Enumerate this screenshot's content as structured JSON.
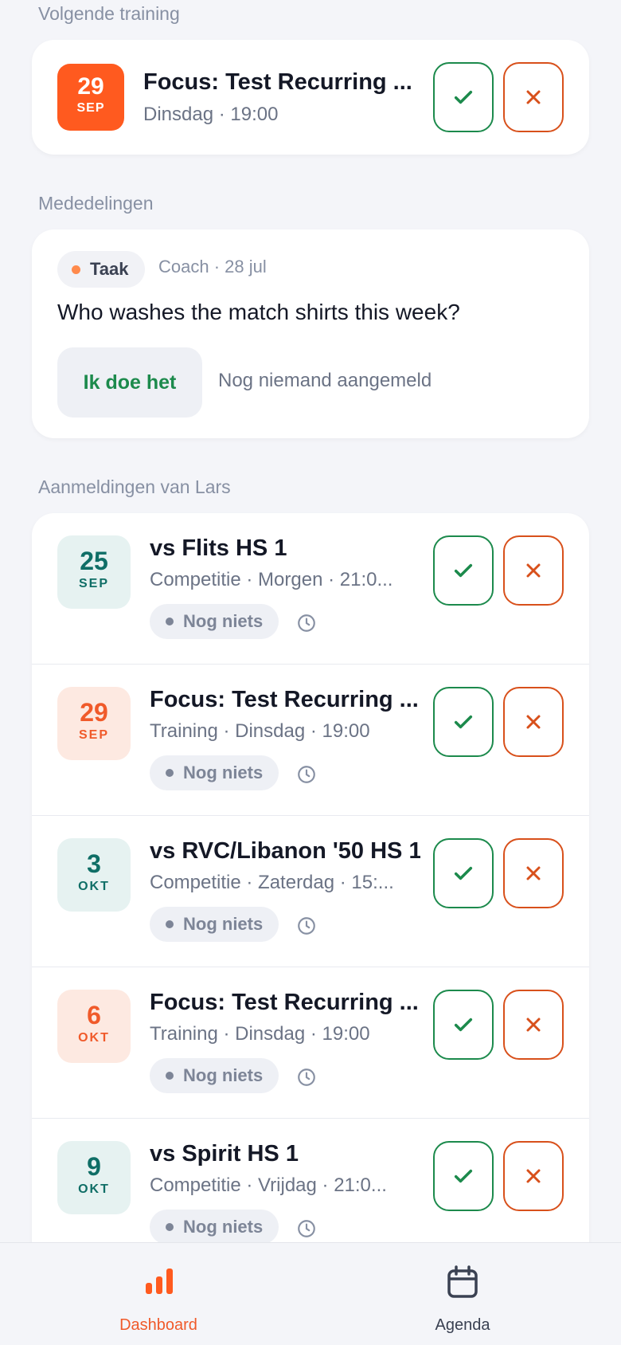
{
  "next_training": {
    "section_label": "Volgende training",
    "day": "29",
    "month": "SEP",
    "title": "Focus: Test Recurring ...",
    "subtitle": "Dinsdag · 19:00"
  },
  "announcements": {
    "section_label": "Mededelingen",
    "tag": "Taak",
    "meta": "Coach · 28 jul",
    "question": "Who washes the match shirts this week?",
    "action_label": "Ik doe het",
    "status": "Nog niemand aangemeld"
  },
  "registrations": {
    "section_label": "Aanmeldingen van Lars",
    "items": [
      {
        "day": "25",
        "month": "SEP",
        "title": "vs Flits HS 1",
        "subtitle": "Competitie · Morgen · 21:0...",
        "status": "Nog niets",
        "kind": "match"
      },
      {
        "day": "29",
        "month": "SEP",
        "title": "Focus: Test Recurring ...",
        "subtitle": "Training · Dinsdag · 19:00",
        "status": "Nog niets",
        "kind": "training"
      },
      {
        "day": "3",
        "month": "OKT",
        "title": "vs RVC/Libanon '50 HS 1",
        "subtitle": "Competitie · Zaterdag · 15:...",
        "status": "Nog niets",
        "kind": "match"
      },
      {
        "day": "6",
        "month": "OKT",
        "title": "Focus: Test Recurring ...",
        "subtitle": "Training · Dinsdag · 19:00",
        "status": "Nog niets",
        "kind": "training"
      },
      {
        "day": "9",
        "month": "OKT",
        "title": "vs Spirit HS 1",
        "subtitle": "Competitie · Vrijdag · 21:0...",
        "status": "Nog niets",
        "kind": "match"
      }
    ]
  },
  "nav": {
    "dashboard_label": "Dashboard",
    "agenda_label": "Agenda",
    "active": "Dashboard"
  },
  "colors": {
    "accent": "#ff5a1f",
    "yes": "#1c8a4c",
    "no": "#d8501b",
    "match_date_bg": "#e6f2f1",
    "training_date_bg": "#fde9e1"
  }
}
